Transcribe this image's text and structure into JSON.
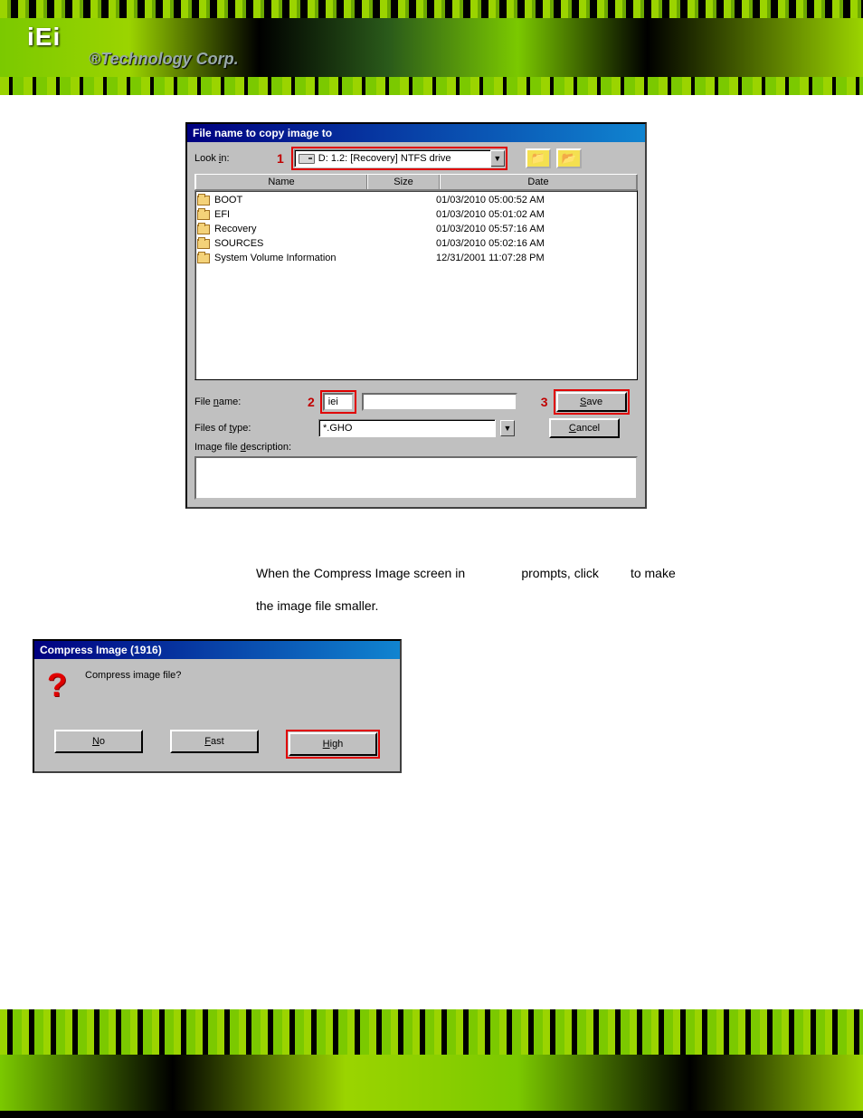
{
  "header": {
    "logo": "iEi",
    "tagline": "®Technology Corp."
  },
  "dialog1": {
    "title": "File name to copy image to",
    "labels": {
      "look_in": "Look in:",
      "file_name": "File name:",
      "files_of_type": "Files of type:",
      "image_desc": "Image file description:"
    },
    "look_in_value": "D: 1.2: [Recovery] NTFS drive",
    "columns": {
      "name": "Name",
      "size": "Size",
      "date": "Date"
    },
    "files": [
      {
        "name": "BOOT",
        "date": "01/03/2010 05:00:52 AM"
      },
      {
        "name": "EFI",
        "date": "01/03/2010 05:01:02 AM"
      },
      {
        "name": "Recovery",
        "date": "01/03/2010 05:57:16 AM"
      },
      {
        "name": "SOURCES",
        "date": "01/03/2010 05:02:16 AM"
      },
      {
        "name": "System Volume Information",
        "date": "12/31/2001 11:07:28 PM"
      }
    ],
    "file_name_value": "iei",
    "files_of_type_value": "*.GHO",
    "buttons": {
      "save": "Save",
      "cancel": "Cancel"
    },
    "annotations": {
      "a1": "1",
      "a2": "2",
      "a3": "3"
    }
  },
  "body_text": {
    "line1a": "When the Compress Image screen in",
    "line1b": "prompts, click",
    "line1c": "to make",
    "line2": "the image file smaller."
  },
  "dialog2": {
    "title": "Compress Image (1916)",
    "message": "Compress image file?",
    "buttons": {
      "no": "No",
      "fast": "Fast",
      "high": "High"
    }
  }
}
